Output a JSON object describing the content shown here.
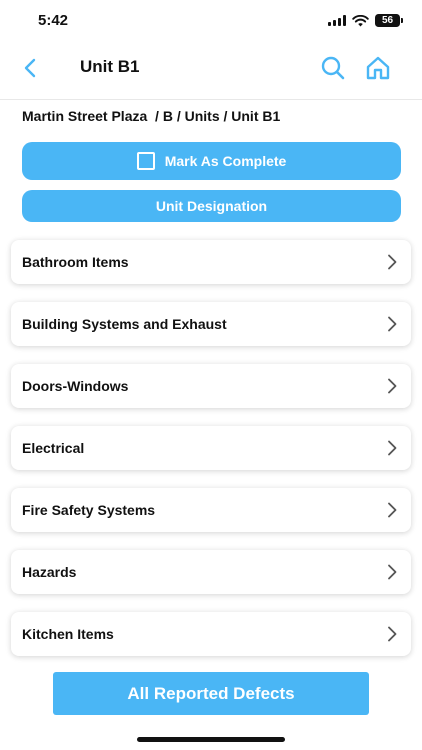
{
  "status_bar": {
    "time": "5:42",
    "battery": "56",
    "icons": [
      "signal-icon",
      "wifi-icon",
      "battery-icon"
    ]
  },
  "nav": {
    "title": "Unit B1",
    "back_icon": "chevron-left-icon",
    "search_icon": "search-icon",
    "home_icon": "home-icon"
  },
  "breadcrumb": "Martin Street Plaza  / B / Units / Unit B1",
  "actions": {
    "mark_complete_label": "Mark As Complete",
    "mark_complete_checked": false,
    "unit_designation_label": "Unit Designation"
  },
  "categories": [
    {
      "label": "Bathroom Items"
    },
    {
      "label": "Building Systems and Exhaust"
    },
    {
      "label": "Doors-Windows"
    },
    {
      "label": "Electrical"
    },
    {
      "label": "Fire Safety Systems"
    },
    {
      "label": "Hazards"
    },
    {
      "label": "Kitchen Items"
    }
  ],
  "footer": {
    "all_defects_label": "All Reported Defects"
  },
  "colors": {
    "accent": "#4ab6f5",
    "text": "#111111",
    "background": "#ffffff"
  }
}
